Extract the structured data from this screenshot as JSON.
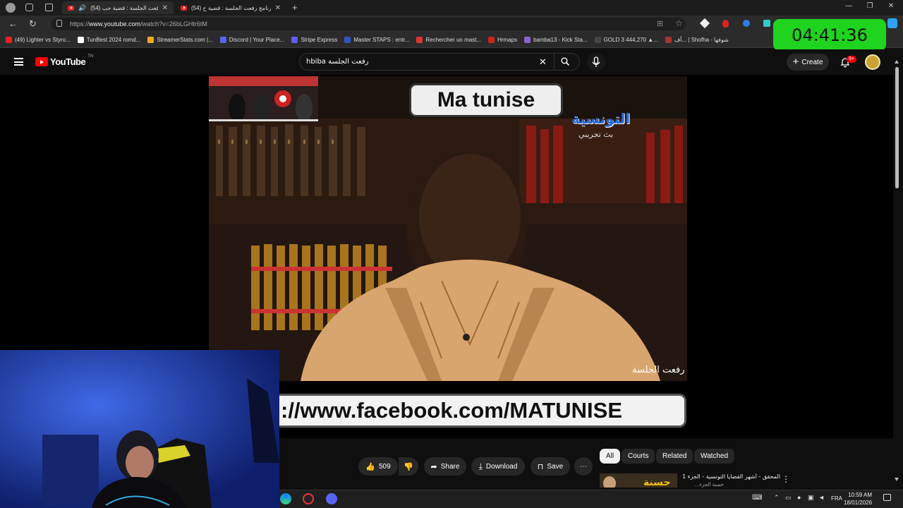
{
  "browser": {
    "tabs": [
      {
        "title": "(54) رفعت الجلسة : قضية حب...",
        "active": true,
        "audio": true
      },
      {
        "title": "(54) برنامج رفعت الجلسة : قضية ح...",
        "active": false
      }
    ],
    "new_tab": "+",
    "window_controls": {
      "minimize": "—",
      "maximize": "❐",
      "close": "✕"
    },
    "url": {
      "prefix": "https://",
      "host": "www.youtube.com",
      "path": "/watch?v=26bLGHtr6tM"
    },
    "bookmarks": [
      {
        "label": "(49) Lighter vs Styro...",
        "color": "#e22"
      },
      {
        "label": "TunBest 2024 romd...",
        "color": "#ffffff"
      },
      {
        "label": "StreamerStats.com |...",
        "color": "#f5a623"
      },
      {
        "label": "Discord | Your Place...",
        "color": "#5865f2"
      },
      {
        "label": "Stripe Express",
        "color": "#635bff"
      },
      {
        "label": "Master STAPS : entr...",
        "color": "#3355cc"
      },
      {
        "label": "Rechercher un mast...",
        "color": "#d33"
      },
      {
        "label": "Hrmaps",
        "color": "#c22"
      },
      {
        "label": "bamba13 - Kick Sta...",
        "color": "#8866cc"
      },
      {
        "label": "GOLD 3 444,270 ▲...",
        "color": "#444"
      },
      {
        "label": "أف... | Shofha - شوفها",
        "color": "#a33"
      }
    ]
  },
  "timer": {
    "value": "04:41:36"
  },
  "youtube": {
    "logo_text": "YouTube",
    "logo_country": "TN",
    "search": {
      "value": "hbiba رفعت الجلسة",
      "clear": "✕"
    },
    "create_label": "Create",
    "notifications_badge": "9+",
    "video": {
      "title_overlay": "Ma tunise",
      "channel_logo_ar": "التونسية",
      "channel_sub_ar": "بث تجريبي",
      "banner_text": "://www.facebook.com/MATUNISE",
      "corner_logo_ar": "رفعت الجلسة"
    },
    "actions": {
      "likes": "509",
      "share": "Share",
      "download": "Download",
      "save": "Save",
      "more": "⋯"
    },
    "chips": [
      "All",
      "Courts",
      "Related",
      "Watched"
    ],
    "suggestion": {
      "title": "المحقق - أشهر القضايا التونسية - الجزء 1 - ...",
      "subtitle": "حسنة الجزء...",
      "thumb_text": "حسنة"
    }
  },
  "taskbar": {
    "lang": "FRA",
    "time": "10:59 AM",
    "date": "18/01/2026"
  }
}
